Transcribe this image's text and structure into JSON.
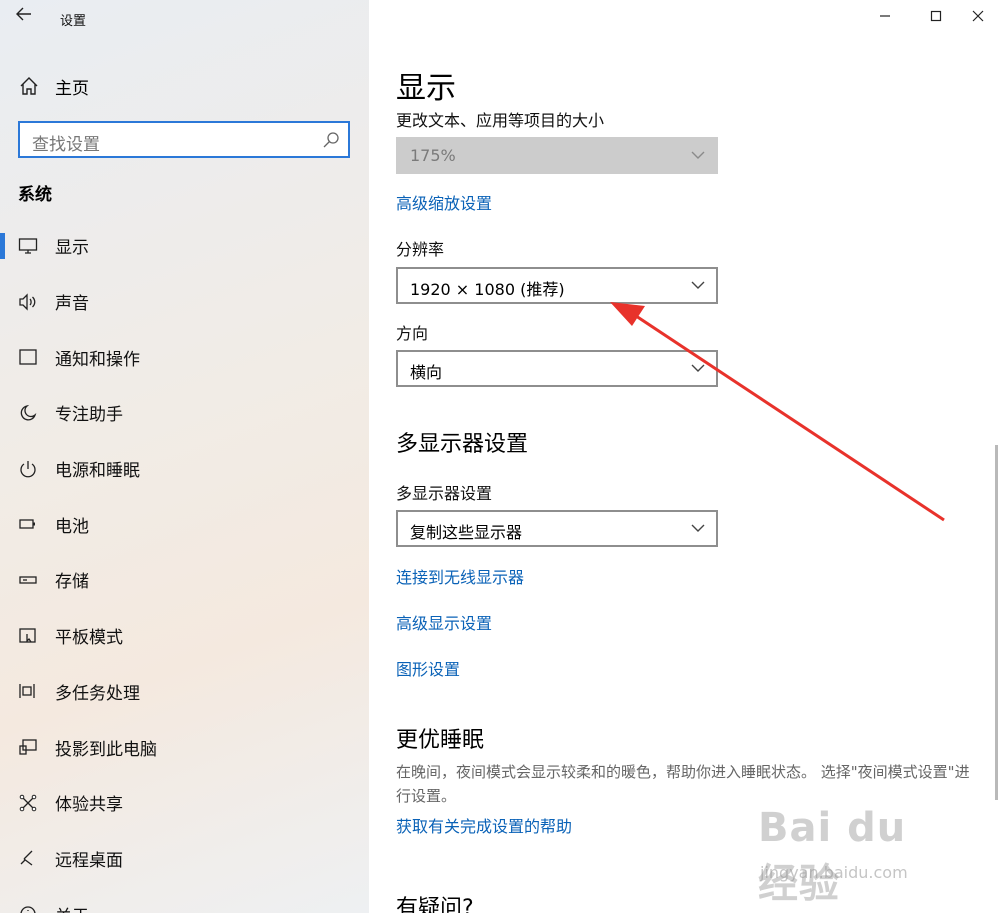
{
  "window": {
    "title": "设置",
    "back_icon": "back-arrow-icon",
    "controls": {
      "minimize": "—",
      "maximize": "☐",
      "close": "✕"
    }
  },
  "sidebar": {
    "home_label": "主页",
    "search_placeholder": "查找设置",
    "section_title": "系统",
    "items": [
      {
        "label": "显示",
        "icon": "monitor-icon",
        "active": true
      },
      {
        "label": "声音",
        "icon": "speaker-icon"
      },
      {
        "label": "通知和操作",
        "icon": "notification-icon"
      },
      {
        "label": "专注助手",
        "icon": "moon-icon"
      },
      {
        "label": "电源和睡眠",
        "icon": "power-icon"
      },
      {
        "label": "电池",
        "icon": "battery-icon"
      },
      {
        "label": "存储",
        "icon": "storage-icon"
      },
      {
        "label": "平板模式",
        "icon": "tablet-icon"
      },
      {
        "label": "多任务处理",
        "icon": "multitask-icon"
      },
      {
        "label": "投影到此电脑",
        "icon": "project-icon"
      },
      {
        "label": "体验共享",
        "icon": "share-icon"
      },
      {
        "label": "远程桌面",
        "icon": "remote-icon"
      },
      {
        "label": "关于",
        "icon": "info-icon"
      }
    ]
  },
  "main": {
    "page_title": "显示",
    "scale_label": "更改文本、应用等项目的大小",
    "scale_value": "175%",
    "advanced_scaling_link": "高级缩放设置",
    "resolution_label": "分辨率",
    "resolution_value": "1920 × 1080 (推荐)",
    "orientation_label": "方向",
    "orientation_value": "横向",
    "multi_display_heading": "多显示器设置",
    "multi_display_label": "多显示器设置",
    "multi_display_value": "复制这些显示器",
    "wireless_link": "连接到无线显示器",
    "advanced_display_link": "高级显示设置",
    "graphics_link": "图形设置",
    "sleep_heading": "更优睡眠",
    "sleep_text": "在晚间，夜间模式会显示较柔和的暖色，帮助你进入睡眠状态。 选择\"夜间模式设置\"进行设置。",
    "sleep_help_link": "获取有关完成设置的帮助",
    "questions_heading": "有疑问?"
  },
  "watermark": {
    "text": "Bai du 经验",
    "url": "jingyan.baidu.com"
  },
  "colors": {
    "accent": "#2b78d8",
    "link": "#0a62b7",
    "annotation_arrow": "#e8322b"
  }
}
